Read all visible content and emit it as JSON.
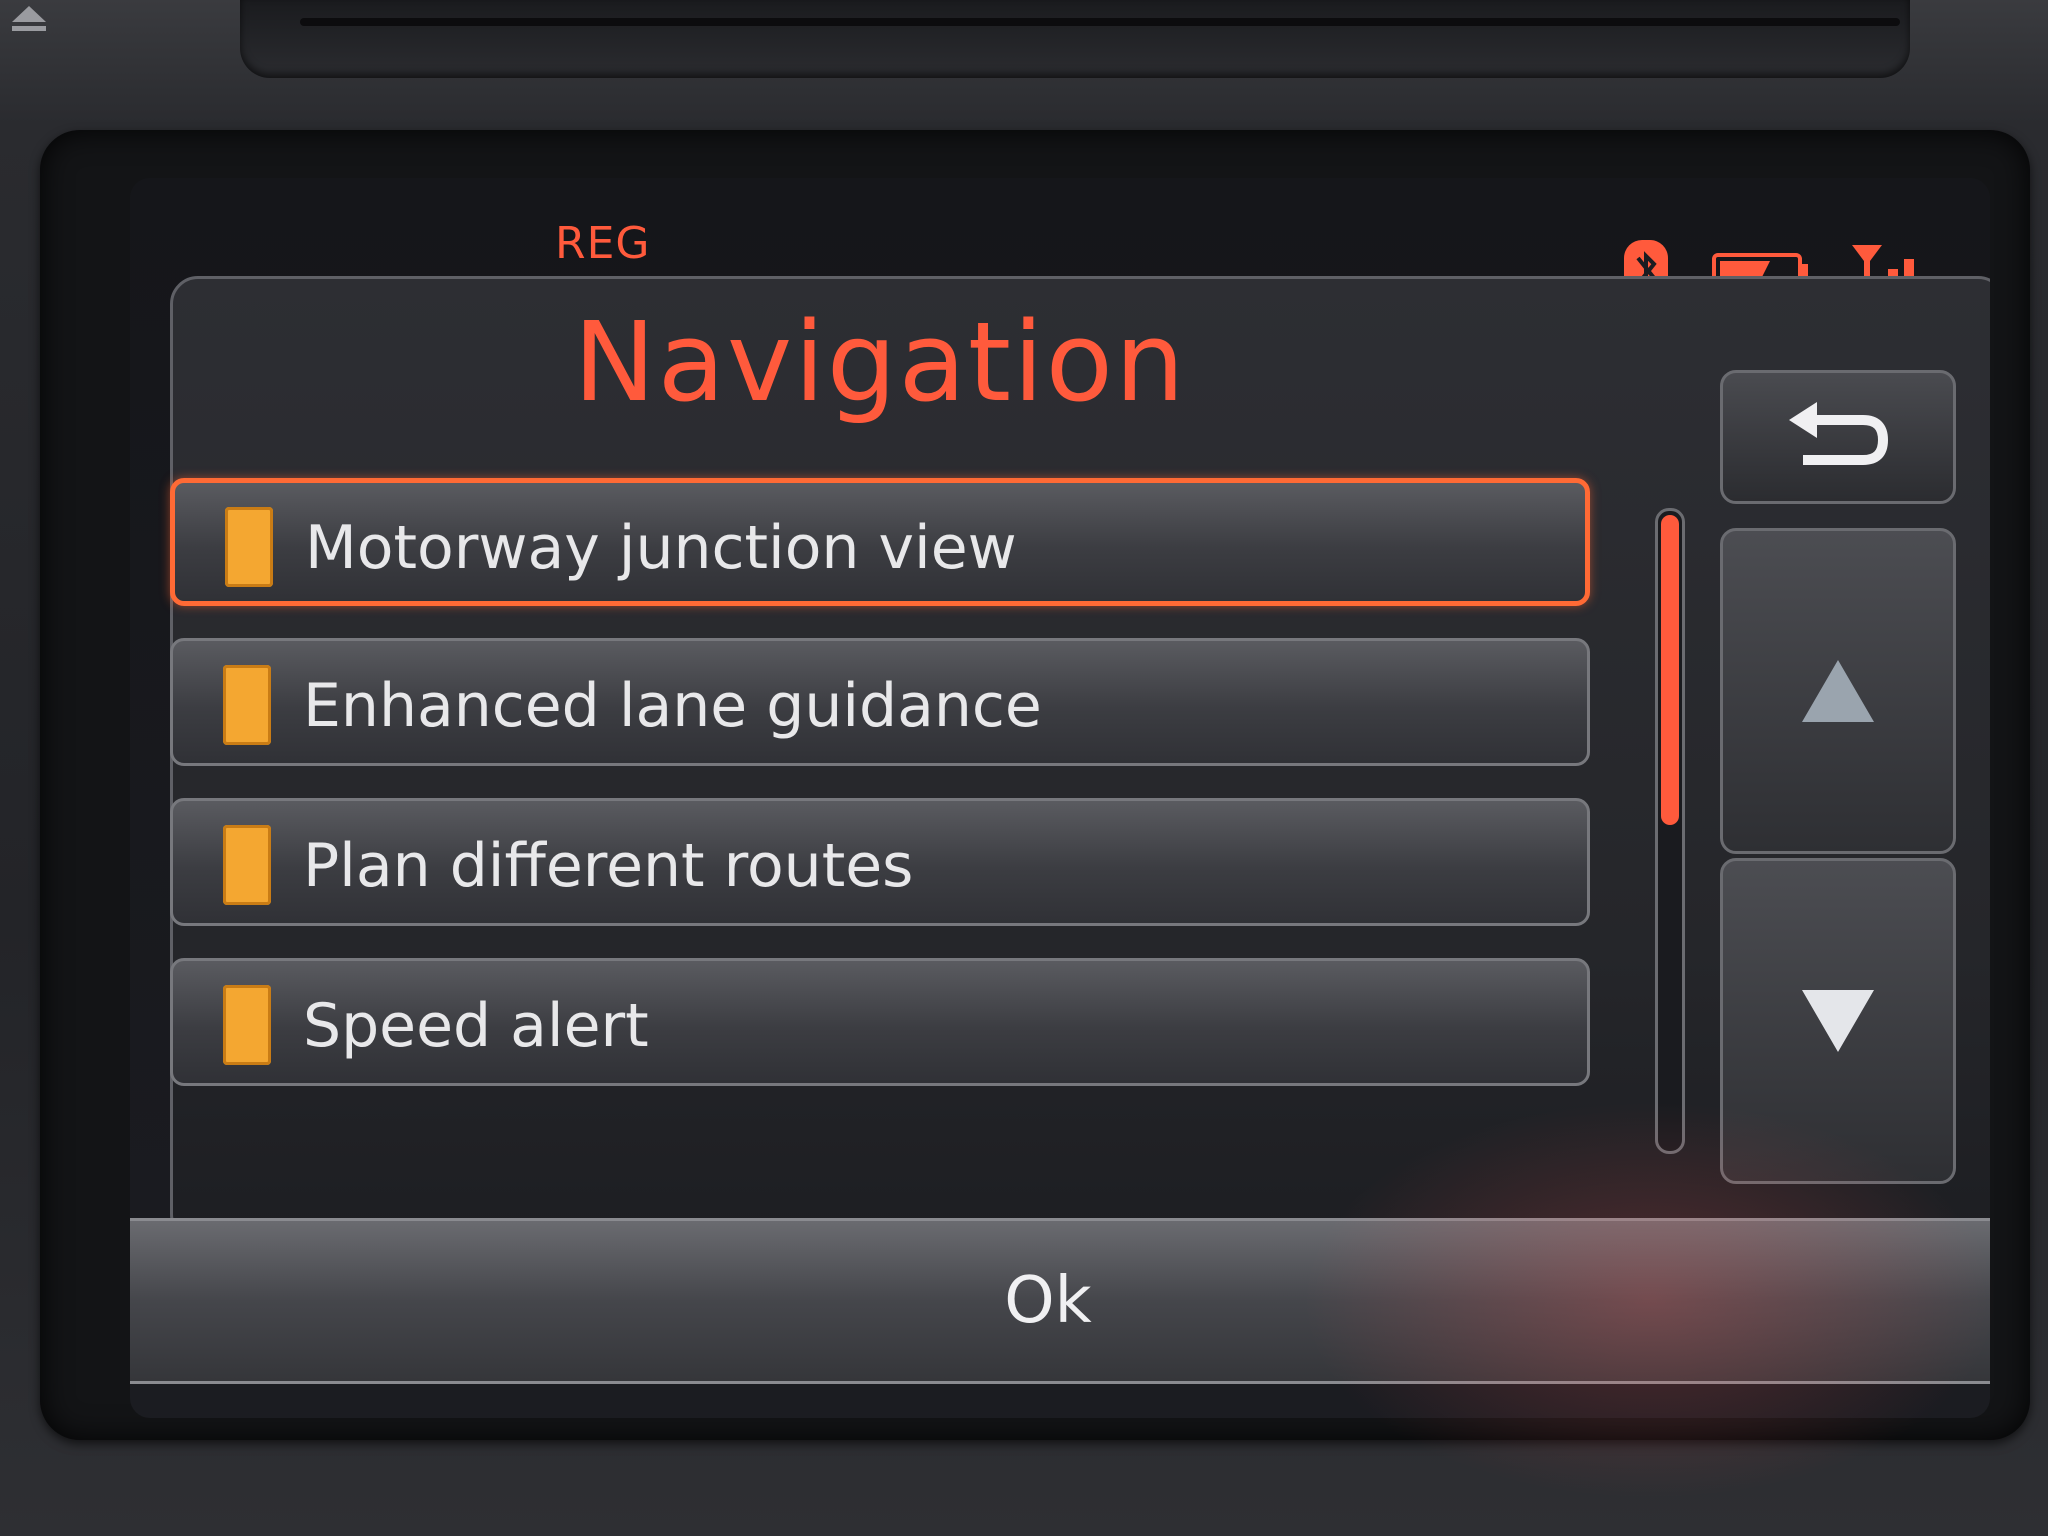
{
  "status_bar": {
    "reg_label": "REG",
    "icons": [
      "bluetooth-icon",
      "battery-icon",
      "signal-icon"
    ],
    "accent_color": "#ff5a3c"
  },
  "screen": {
    "title": "Navigation",
    "back_icon": "back-arrow-icon"
  },
  "list": {
    "items": [
      {
        "label": "Motorway junction view",
        "selected": true,
        "checked": true
      },
      {
        "label": "Enhanced lane guidance",
        "selected": false,
        "checked": true
      },
      {
        "label": "Plan different routes",
        "selected": false,
        "checked": true
      },
      {
        "label": "Speed alert",
        "selected": false,
        "checked": true
      }
    ],
    "checkbox_color": "#f4a731",
    "scroll_position_fraction": 0.45
  },
  "scroll": {
    "up_icon": "arrow-up-icon",
    "down_icon": "arrow-down-icon"
  },
  "footer": {
    "ok_label": "Ok"
  }
}
